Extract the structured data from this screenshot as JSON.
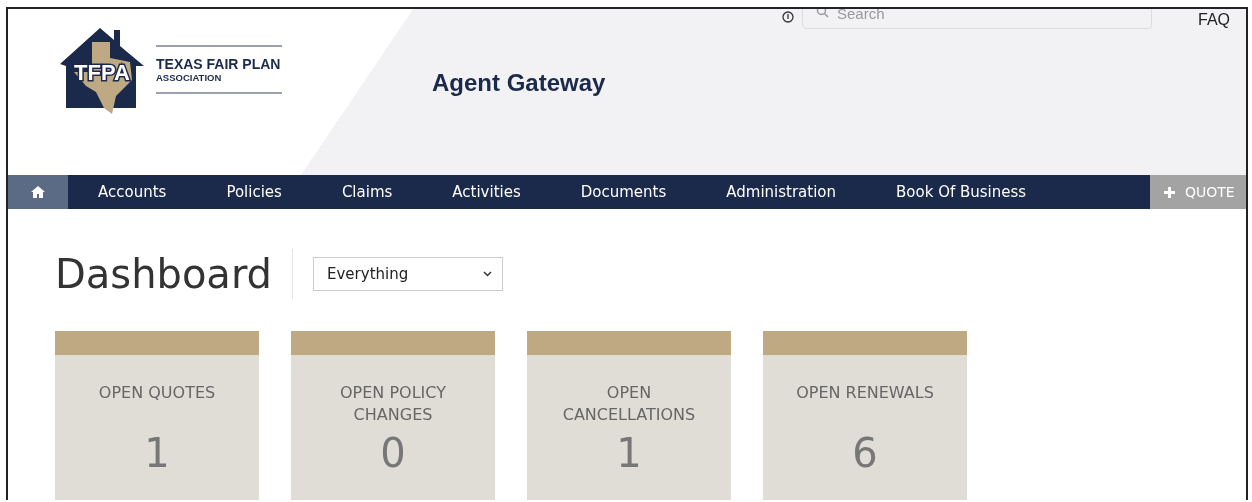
{
  "header": {
    "logo": {
      "mark": "TFPA",
      "name": "TEXAS FAIR PLAN",
      "subtitle": "ASSOCIATION"
    },
    "title": "Agent Gateway",
    "search": {
      "placeholder": "Search"
    },
    "faq": "FAQ"
  },
  "nav": {
    "items": [
      {
        "kind": "home"
      },
      {
        "kind": "link",
        "label": "Accounts"
      },
      {
        "kind": "link",
        "label": "Policies"
      },
      {
        "kind": "link",
        "label": "Claims"
      },
      {
        "kind": "link",
        "label": "Activities"
      },
      {
        "kind": "link",
        "label": "Documents"
      },
      {
        "kind": "link",
        "label": "Administration"
      },
      {
        "kind": "link",
        "label": "Book Of Business"
      }
    ],
    "action": "QUOTE"
  },
  "dashboard": {
    "title": "Dashboard",
    "filter": "Everything",
    "cards": [
      {
        "label": "OPEN QUOTES",
        "count": "1"
      },
      {
        "label": "OPEN POLICY CHANGES",
        "count": "0"
      },
      {
        "label": "OPEN CANCELLATIONS",
        "count": "1"
      },
      {
        "label": "OPEN RENEWALS",
        "count": "6"
      }
    ]
  }
}
